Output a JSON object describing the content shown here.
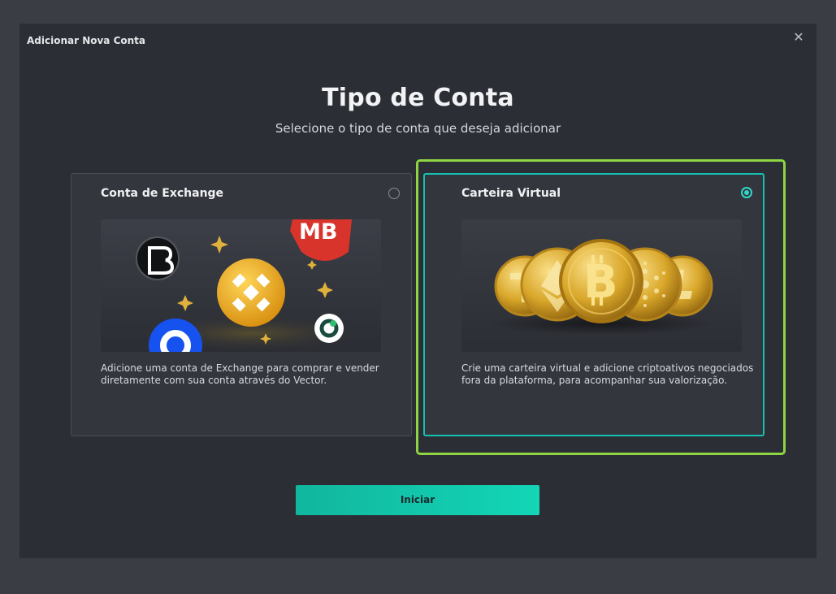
{
  "dialog": {
    "title": "Adicionar Nova Conta",
    "close_glyph": "✕",
    "heading": "Tipo de Conta",
    "subheading": "Selecione o tipo de conta que deseja adicionar"
  },
  "options": [
    {
      "title": "Conta de Exchange",
      "description": "Adicione uma conta de Exchange para comprar e vender diretamente com sua conta através do Vector.",
      "selected": false,
      "illustration": "exchange-logos-illustration",
      "logo_text": "MB"
    },
    {
      "title": "Carteira Virtual",
      "description": "Crie uma carteira virtual e adicione criptoativos negociados fora da plataforma, para acompanhar sua valorização.",
      "selected": true,
      "illustration": "crypto-coins-illustration"
    }
  ],
  "actions": {
    "start_label": "Iniciar"
  },
  "colors": {
    "accent": "#14c0b0",
    "highlight": "#8fd442",
    "background": "#2c2e35"
  }
}
